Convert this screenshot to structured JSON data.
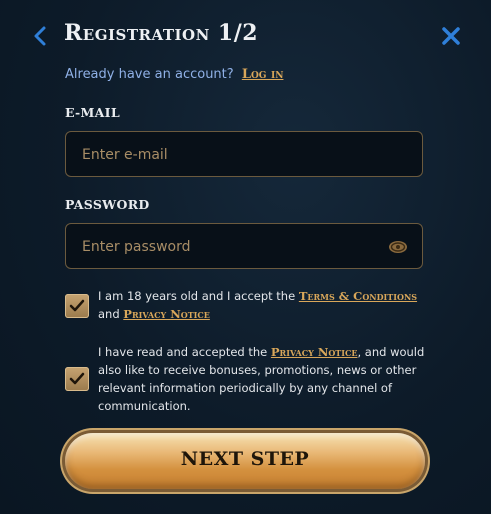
{
  "header": {
    "title": "Registration 1/2"
  },
  "login": {
    "prompt": "Already have an account?",
    "link": "Log in"
  },
  "email": {
    "label": "E-MAIL",
    "placeholder": "Enter e-mail",
    "value": ""
  },
  "password": {
    "label": "PASSWORD",
    "placeholder": "Enter password",
    "value": ""
  },
  "terms": {
    "checked": true,
    "text_before": "I am 18 years old and I accept the ",
    "link1": "Terms & Conditions",
    "text_mid": " and ",
    "link2": "Privacy Notice"
  },
  "marketing": {
    "checked": true,
    "text_before": "I have read and accepted the ",
    "link": "Privacy Notice",
    "text_after": ", and would also like to receive bonuses, promotions, news or other relevant information periodically by any channel of communication."
  },
  "next_button": {
    "label": "NEXT STEP"
  },
  "colors": {
    "accent_gold": "#d9a75a",
    "link_blue": "#8fb0e6",
    "icon_blue": "#2f7fd8",
    "background": "#0d1b29"
  }
}
